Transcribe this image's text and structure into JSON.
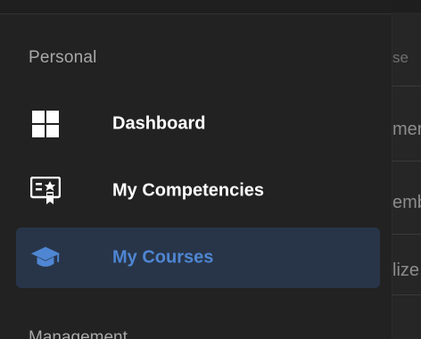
{
  "background": {
    "cells": [
      "se",
      "mers",
      "emb",
      "lize"
    ]
  },
  "sidebar": {
    "section_personal": "Personal",
    "items": [
      {
        "label": "Dashboard",
        "icon": "dashboard-grid-icon"
      },
      {
        "label": "My Competencies",
        "icon": "competency-badge-icon"
      },
      {
        "label": "My Courses",
        "icon": "graduation-cap-icon",
        "active": true
      }
    ],
    "section_next": "Management"
  },
  "colors": {
    "accent": "#4f86d3",
    "active_bg": "#283549",
    "drawer_bg": "#222222"
  }
}
